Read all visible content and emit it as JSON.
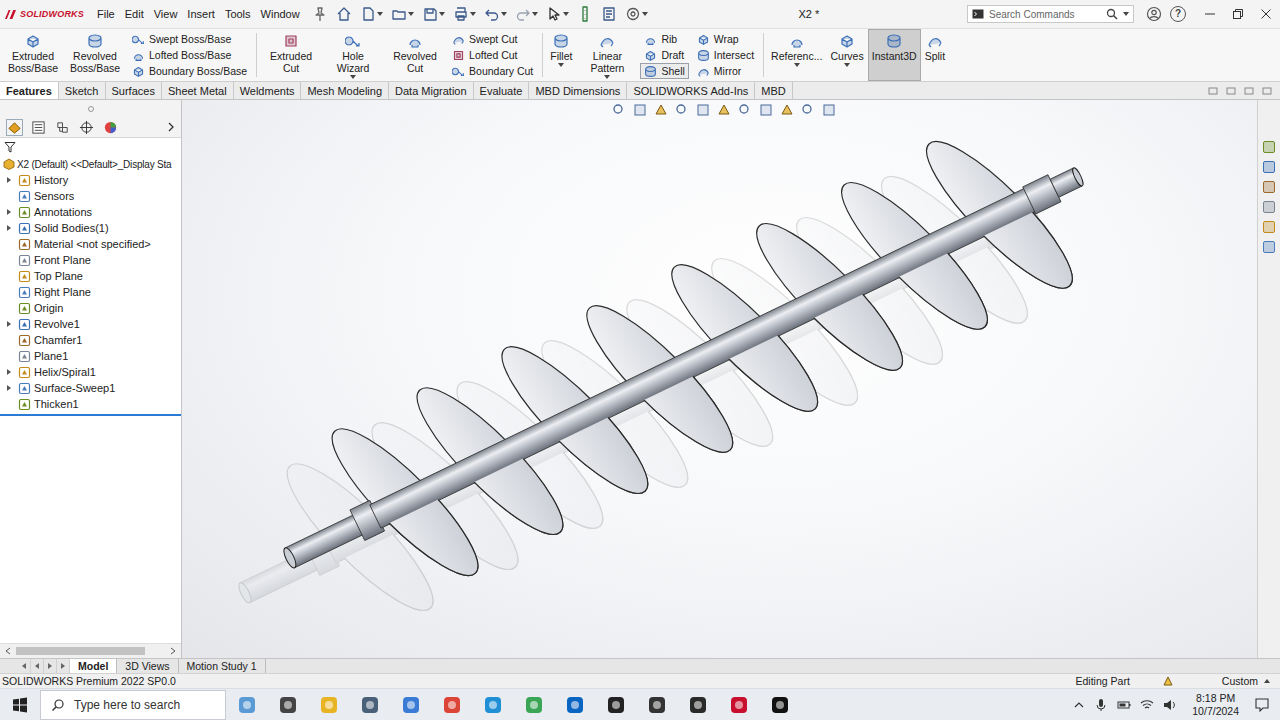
{
  "window": {
    "title": "X2 *"
  },
  "logo": "SOLIDWORKS",
  "menu": [
    "File",
    "Edit",
    "View",
    "Insert",
    "Tools",
    "Window"
  ],
  "search": {
    "placeholder": "Search Commands"
  },
  "help_icon": "?",
  "ribbon": [
    {
      "kind": "large",
      "label": "Extruded Boss/Base",
      "dropdown": false,
      "selected": false
    },
    {
      "kind": "large",
      "label": "Revolved Boss/Base",
      "dropdown": false,
      "selected": false
    },
    {
      "kind": "stack",
      "items": [
        {
          "label": "Swept Boss/Base",
          "selected": false
        },
        {
          "label": "Lofted Boss/Base",
          "selected": false
        },
        {
          "label": "Boundary Boss/Base",
          "selected": false
        }
      ]
    },
    {
      "kind": "large",
      "label": "Extruded Cut",
      "dropdown": false,
      "selected": false
    },
    {
      "kind": "large",
      "label": "Hole Wizard",
      "dropdown": true,
      "selected": false
    },
    {
      "kind": "large",
      "label": "Revolved Cut",
      "dropdown": false,
      "selected": false
    },
    {
      "kind": "stack",
      "items": [
        {
          "label": "Swept Cut",
          "selected": false
        },
        {
          "label": "Lofted Cut",
          "selected": false
        },
        {
          "label": "Boundary Cut",
          "selected": false
        }
      ]
    },
    {
      "kind": "large",
      "label": "Fillet",
      "dropdown": true,
      "selected": false
    },
    {
      "kind": "large",
      "label": "Linear Pattern",
      "dropdown": true,
      "selected": false
    },
    {
      "kind": "stack",
      "items": [
        {
          "label": "Rib",
          "selected": false
        },
        {
          "label": "Draft",
          "selected": false
        },
        {
          "label": "Shell",
          "selected": true
        }
      ]
    },
    {
      "kind": "stack",
      "items": [
        {
          "label": "Wrap",
          "selected": false
        },
        {
          "label": "Intersect",
          "selected": false
        },
        {
          "label": "Mirror",
          "selected": false
        }
      ]
    },
    {
      "kind": "large",
      "label": "Referenc...",
      "dropdown": true,
      "selected": false
    },
    {
      "kind": "large",
      "label": "Curves",
      "dropdown": true,
      "selected": false
    },
    {
      "kind": "large",
      "label": "Instant3D",
      "dropdown": false,
      "selected": true
    },
    {
      "kind": "large",
      "label": "Split",
      "dropdown": false,
      "selected": false
    }
  ],
  "tabs": [
    {
      "label": "Features",
      "selected": true
    },
    {
      "label": "Sketch",
      "selected": false
    },
    {
      "label": "Surfaces",
      "selected": false
    },
    {
      "label": "Sheet Metal",
      "selected": false
    },
    {
      "label": "Weldments",
      "selected": false
    },
    {
      "label": "Mesh Modeling",
      "selected": false
    },
    {
      "label": "Data Migration",
      "selected": false
    },
    {
      "label": "Evaluate",
      "selected": false
    },
    {
      "label": "MBD Dimensions",
      "selected": false
    },
    {
      "label": "SOLIDWORKS Add-Ins",
      "selected": false
    },
    {
      "label": "MBD",
      "selected": false
    }
  ],
  "tree": {
    "root": "X2 (Default) <<Default>_Display Sta",
    "items": [
      {
        "label": "History",
        "expandable": true,
        "expanded": false
      },
      {
        "label": "Sensors",
        "expandable": false,
        "expanded": false
      },
      {
        "label": "Annotations",
        "expandable": true,
        "expanded": false
      },
      {
        "label": "Solid Bodies(1)",
        "expandable": true,
        "expanded": false
      },
      {
        "label": "Material <not specified>",
        "expandable": false,
        "expanded": false
      },
      {
        "label": "Front Plane",
        "expandable": false,
        "expanded": false
      },
      {
        "label": "Top Plane",
        "expandable": false,
        "expanded": false
      },
      {
        "label": "Right Plane",
        "expandable": false,
        "expanded": false
      },
      {
        "label": "Origin",
        "expandable": false,
        "expanded": false
      },
      {
        "label": "Revolve1",
        "expandable": true,
        "expanded": false
      },
      {
        "label": "Chamfer1",
        "expandable": false,
        "expanded": false
      },
      {
        "label": "Plane1",
        "expandable": false,
        "expanded": false
      },
      {
        "label": "Helix/Spiral1",
        "expandable": true,
        "expanded": false
      },
      {
        "label": "Surface-Sweep1",
        "expandable": true,
        "expanded": false
      },
      {
        "label": "Thicken1",
        "expandable": false,
        "expanded": false
      }
    ]
  },
  "bottom_tabs": [
    {
      "label": "Model",
      "selected": true
    },
    {
      "label": "3D Views",
      "selected": false
    },
    {
      "label": "Motion Study 1",
      "selected": false
    }
  ],
  "status_bar": {
    "product": "SOLIDWORKS Premium 2022 SP0.0",
    "mode": "Editing Part",
    "units": "Custom"
  },
  "taskbar": {
    "search_placeholder": "Type here to search",
    "time": "8:18 PM",
    "date": "10/7/2024"
  }
}
